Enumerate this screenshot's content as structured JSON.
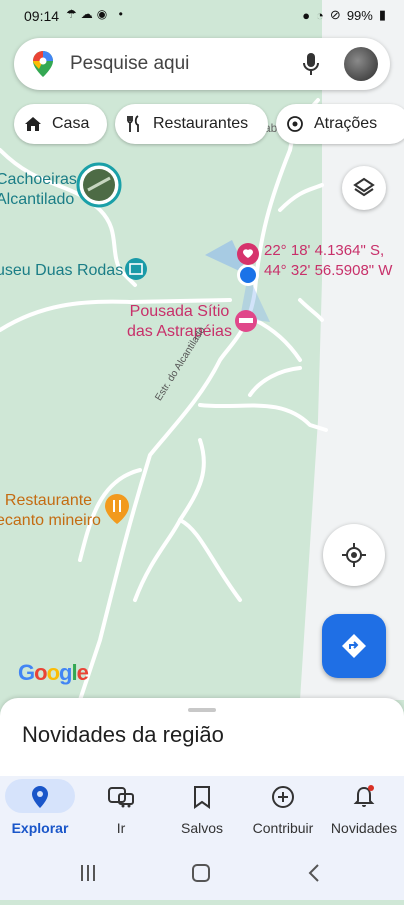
{
  "status_bar": {
    "time": "09:14",
    "battery": "99%",
    "icons": [
      "location-icon",
      "wifi-icon",
      "dnd-icon",
      "battery-icon"
    ]
  },
  "search": {
    "placeholder": "Pesquise aqui"
  },
  "chips": [
    {
      "label": "Casa",
      "icon": "home-icon"
    },
    {
      "label": "Restaurantes",
      "icon": "fork-knife-icon"
    },
    {
      "label": "Atrações",
      "icon": "attraction-icon"
    }
  ],
  "map": {
    "places": {
      "cachoeiras": [
        "Cachoeiras",
        "Alcantilado"
      ],
      "museu": "useu Duas Rodas",
      "pousada": [
        "Pousada Sítio",
        "das Astrapéias"
      ],
      "restaurante": [
        "Restaurante",
        "ecanto mineiro"
      ],
      "road": "Estr. do Alcantilado",
      "partial": "ab"
    },
    "coordinates": [
      "22° 18' 4.1364\" S,",
      "44° 32' 56.5908\" W"
    ],
    "attribution": "Google",
    "colors": {
      "land": "#cfe7d6",
      "road": "#ffffff",
      "teal_label": "#1a7d86",
      "pink_label": "#c8306a",
      "orange_label": "#c46c12",
      "location_dot": "#1a73e8",
      "directions_button": "#1f6fe5"
    }
  },
  "sheet": {
    "title": "Novidades da região"
  },
  "bottom_nav": [
    {
      "label": "Explorar",
      "icon": "explore-pin-icon",
      "active": true
    },
    {
      "label": "Ir",
      "icon": "commute-icon"
    },
    {
      "label": "Salvos",
      "icon": "bookmark-icon"
    },
    {
      "label": "Contribuir",
      "icon": "add-circle-icon"
    },
    {
      "label": "Novidades",
      "icon": "bell-icon"
    }
  ]
}
